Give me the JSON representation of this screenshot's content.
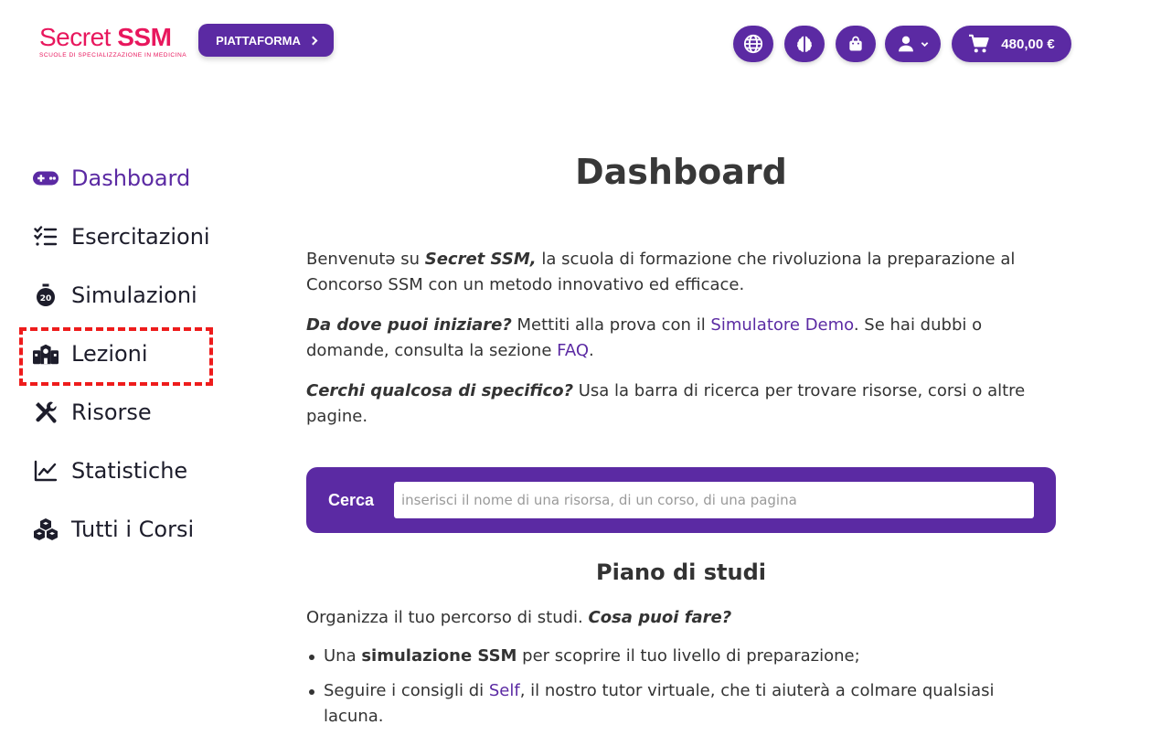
{
  "colors": {
    "accent": "#5b2aa3",
    "brand": "#e8175d",
    "highlight": "#ee1c1c"
  },
  "header": {
    "logo_main": "Secret SSM",
    "logo_secret": "Secret",
    "logo_ssm": "SSM",
    "logo_sub": "SCUOLE DI SPECIALIZZAZIONE IN MEDICINA",
    "platform_label": "PIATTAFORMA",
    "icons": [
      "globe-icon",
      "brain-icon",
      "bag-icon",
      "user-icon",
      "cart-icon"
    ],
    "cart_total": "480,00 €"
  },
  "sidebar": {
    "items": [
      {
        "label": "Dashboard",
        "icon": "gamepad-icon",
        "active": true
      },
      {
        "label": "Esercitazioni",
        "icon": "checklist-icon"
      },
      {
        "label": "Simulazioni",
        "icon": "stopwatch-icon"
      },
      {
        "label": "Lezioni",
        "icon": "school-icon",
        "highlighted": true
      },
      {
        "label": "Risorse",
        "icon": "tools-icon"
      },
      {
        "label": "Statistiche",
        "icon": "chart-line-icon"
      },
      {
        "label": "Tutti i Corsi",
        "icon": "cubes-icon"
      }
    ]
  },
  "main": {
    "title": "Dashboard",
    "intro": {
      "p1_prefix": "Benvenutə su ",
      "p1_brand": "Secret SSM,",
      "p1_suffix": " la scuola di formazione che rivoluziona la preparazione al Concorso SSM con un metodo innovativo ed efficace.",
      "p2_lead": "Da dove puoi iniziare?",
      "p2_mid": " Mettiti alla prova con il ",
      "p2_link1": "Simulatore Demo",
      "p2_mid2": ". Se hai dubbi o domande, consulta la sezione ",
      "p2_link2": "FAQ",
      "p2_end": ".",
      "p3_lead": "Cerchi qualcosa di specifico?",
      "p3_rest": " Usa la barra di ricerca per trovare risorse, corsi o altre pagine."
    },
    "search": {
      "label": "Cerca",
      "placeholder": "inserisci il nome di una risorsa, di un corso, di una pagina",
      "value": ""
    },
    "plan": {
      "title": "Piano di studi",
      "intro_text": "Organizza il tuo percorso di studi. ",
      "intro_italic": "Cosa puoi fare?",
      "bullet1_prefix": "Una ",
      "bullet1_bold": "simulazione SSM",
      "bullet1_suffix": " per scoprire il tuo livello di preparazione;",
      "bullet2_prefix": "Seguire i consigli di ",
      "bullet2_link": "Self",
      "bullet2_suffix": ", il nostro tutor virtuale, che ti aiuterà a colmare qualsiasi lacuna."
    }
  }
}
